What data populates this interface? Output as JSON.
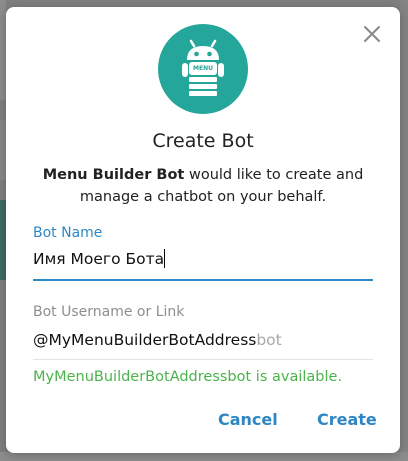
{
  "dialog": {
    "title": "Create Bot",
    "description_bold": "Menu Builder Bot",
    "description_rest": " would like to create and manage a chatbot on your behalf.",
    "avatar_text": "MENU",
    "close_icon": "close-icon"
  },
  "bot_name": {
    "label": "Bot Name",
    "value": "Имя Моего Бота"
  },
  "bot_username": {
    "label": "Bot Username or Link",
    "prefix": "@MyMenuBuilderBotAddress",
    "suffix": "bot"
  },
  "status": {
    "message": "MyMenuBuilderBotAddressbot is available."
  },
  "buttons": {
    "cancel": "Cancel",
    "create": "Create"
  },
  "colors": {
    "accent": "#2e87c4",
    "avatar_bg": "#25a69a",
    "success": "#4bb34b"
  }
}
